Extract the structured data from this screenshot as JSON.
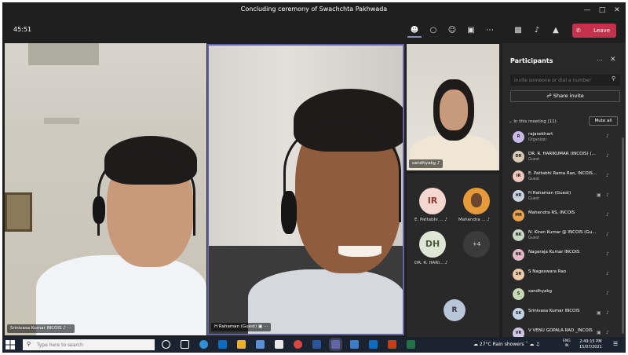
{
  "window": {
    "title": "Concluding ceremony of Swachchta Pakhwada"
  },
  "toolbar": {
    "timer": "45:51",
    "icons": [
      "people-icon",
      "chat-icon",
      "reactions-icon",
      "share-screen-icon",
      "more-icon",
      "camera-off-icon",
      "mic-off-icon",
      "share-tray-icon"
    ],
    "leave_label": "Leave",
    "leave_color": "#c4314b"
  },
  "videos": {
    "v1": {
      "name": "Srinivasa Kumar INCOIS"
    },
    "v2": {
      "name": "H Rahaman (Guest)"
    },
    "v3": {
      "name": "sandhyakg"
    }
  },
  "tiles": {
    "ir": {
      "initials": "IR",
      "label": "E. Pattabhi ..."
    },
    "mr": {
      "label": "Mahendra ..."
    },
    "dh": {
      "initials": "DH",
      "label": "DR. R. HARI..."
    },
    "more": "+4",
    "r": "R"
  },
  "panel": {
    "title": "Participants",
    "invite_placeholder": "Invite someone or dial a number",
    "share_invite": "Share invite",
    "in_meeting": "In this meeting (11)",
    "mute_all": "Mute all",
    "participants": [
      {
        "initials": "R",
        "name": "rajasekhart",
        "role": "Organizer",
        "color": "#c7b9e6"
      },
      {
        "initials": "DR",
        "name": "DR. R. HARIKUMAR (INCOIS) (...",
        "role": "Guest",
        "color": "#d6cbb3"
      },
      {
        "initials": "IR",
        "name": "E. Pattabhi Rama Rao, INCOIS...",
        "role": "Guest",
        "color": "#efc7bd"
      },
      {
        "initials": "HR",
        "name": "H Rahaman (Guest)",
        "role": "Guest",
        "color": "#c9d3df"
      },
      {
        "initials": "MR",
        "name": "Mahendra RS, INCOIS",
        "role": "",
        "color": "#e9a24a"
      },
      {
        "initials": "NK",
        "name": "N. Kiran Kumar @ INCOIS (Gu...",
        "role": "Guest",
        "color": "#c8d9c2"
      },
      {
        "initials": "NK",
        "name": "Nagaraja Kumar INCOIS",
        "role": "",
        "color": "#e3b9c9"
      },
      {
        "initials": "SR",
        "name": "S Nageswara Rao",
        "role": "",
        "color": "#f0c9a7"
      },
      {
        "initials": "S",
        "name": "sandhyakg",
        "role": "",
        "color": "#c6d9b4"
      },
      {
        "initials": "SK",
        "name": "Srinivasa Kumar INCOIS",
        "role": "",
        "color": "#c2d3e6"
      },
      {
        "initials": "VR",
        "name": "V VENU GOPALA RAO _INCOIS",
        "role": "",
        "color": "#d3c7e7"
      }
    ]
  },
  "taskbar": {
    "search_placeholder": "Type here to search",
    "weather": "27°C  Rain showers",
    "lang_top": "ENG",
    "lang_bottom": "IN",
    "time": "2:49:15 PM",
    "date": "15/07/2021"
  }
}
